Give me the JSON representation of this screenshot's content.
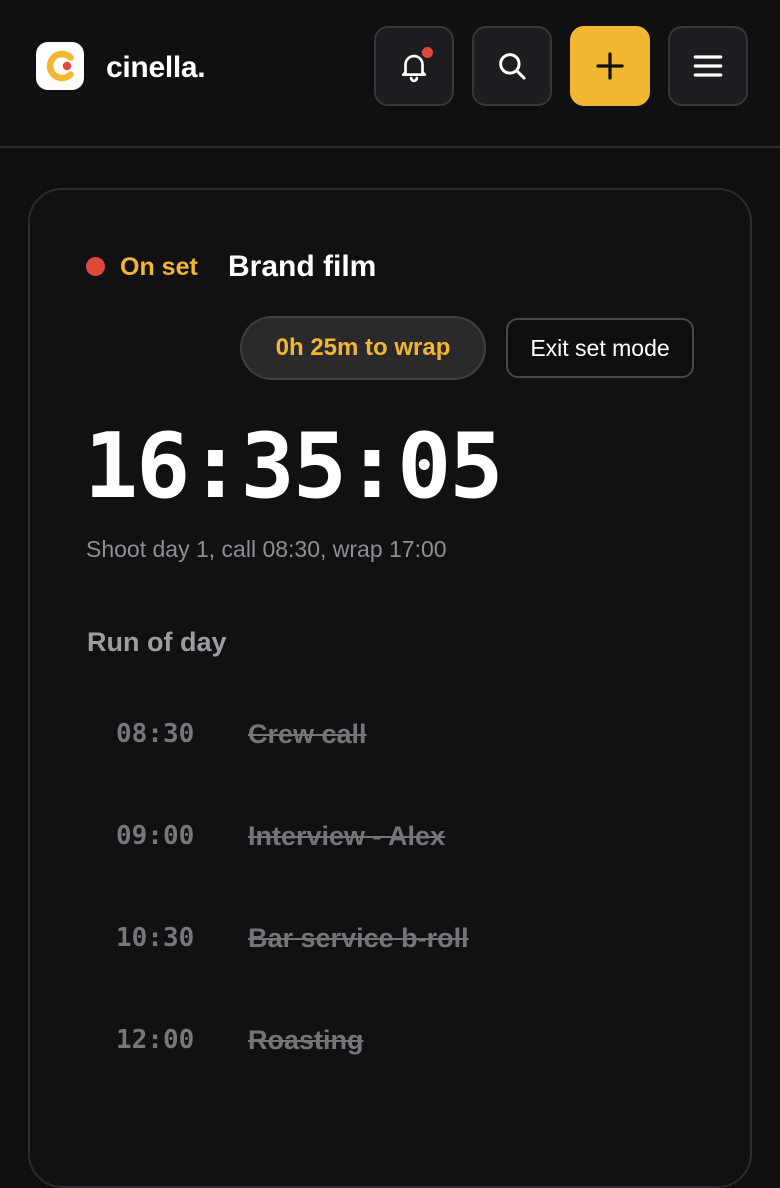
{
  "header": {
    "brand": "cinella.",
    "colors": {
      "accent": "#f3b630",
      "notification": "#e0483a"
    },
    "icons": [
      "bell-icon",
      "search-icon",
      "plus-icon",
      "menu-icon"
    ]
  },
  "status": {
    "label": "On set",
    "project": "Brand film",
    "time_to_wrap": "0h 25m to wrap",
    "exit_label": "Exit set mode",
    "clock": "16:35:05",
    "subline": "Shoot day 1, call 08:30, wrap 17:00"
  },
  "run_of_day": {
    "title": "Run of day",
    "items": [
      {
        "time": "08:30",
        "label": "Crew call"
      },
      {
        "time": "09:00",
        "label": "Interview - Alex"
      },
      {
        "time": "10:30",
        "label": "Bar service b-roll"
      },
      {
        "time": "12:00",
        "label": "Roasting"
      }
    ]
  }
}
